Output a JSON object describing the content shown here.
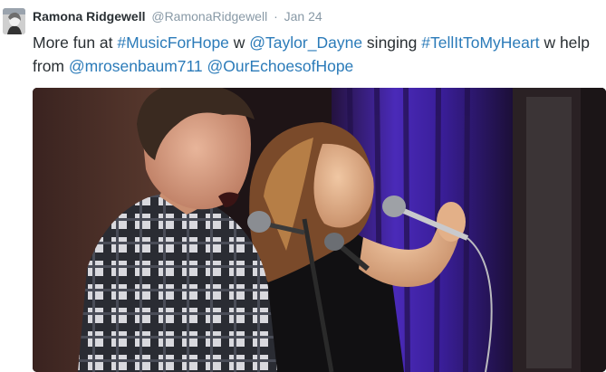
{
  "tweet": {
    "author_name": "Ramona Ridgewell",
    "author_handle": "@RamonaRidgewell",
    "separator": "·",
    "timestamp": "Jan 24",
    "text_parts": [
      {
        "type": "text",
        "value": "More fun at "
      },
      {
        "type": "link",
        "value": "#MusicForHope"
      },
      {
        "type": "text",
        "value": " w "
      },
      {
        "type": "link",
        "value": "@Taylor_Dayne"
      },
      {
        "type": "text",
        "value": " singing "
      },
      {
        "type": "link",
        "value": "#TellItToMyHeart"
      },
      {
        "type": "text",
        "value": " w help from "
      },
      {
        "type": "link",
        "value": "@mrosenbaum711"
      },
      {
        "type": "text",
        "value": " "
      },
      {
        "type": "link",
        "value": "@OurEchoesofHope"
      }
    ]
  },
  "colors": {
    "link": "#2b7bb9",
    "text": "#292f33",
    "muted": "#8899a6",
    "stage_curtain": "#3b1f9a"
  }
}
